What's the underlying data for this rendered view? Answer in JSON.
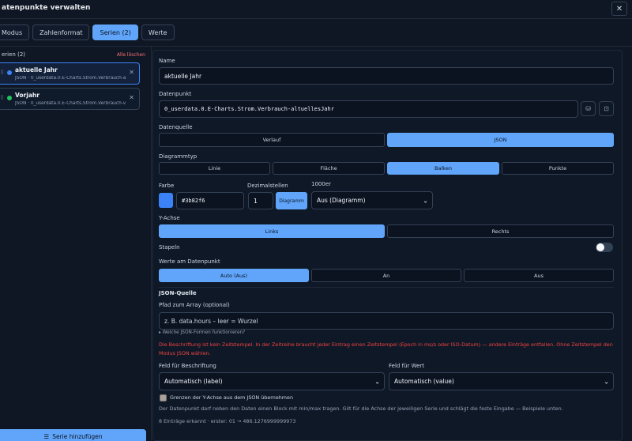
{
  "window": {
    "title": "atenpunkte verwalten",
    "close_glyph": "✕"
  },
  "tabs": [
    {
      "label": "Modus"
    },
    {
      "label": "Zahlenformat"
    },
    {
      "label": "Serien (2)"
    },
    {
      "label": "Werte"
    }
  ],
  "sidebar": {
    "header": "erien (2)",
    "clear_all": "Alle löschen",
    "items": [
      {
        "name": "aktuelle Jahr",
        "sub": "JSON · 0_userdata.0.E-Charts.Strom.Verbrauch-a...",
        "dot_color": "#3b82f6"
      },
      {
        "name": "Vorjahr",
        "sub": "JSON · 0_userdata.0.E-Charts.Strom.Verbrauch-v...",
        "dot_color": "#22c55e"
      }
    ],
    "add_button": "Serie hinzufügen"
  },
  "form": {
    "name_label": "Name",
    "name_value": "aktuelle Jahr",
    "datapoint_label": "Datenpunkt",
    "datapoint_value": "0_userdata.0.E-Charts.Strom.Verbrauch-altuellesJahr",
    "source_label": "Datenquelle",
    "source_options": [
      "Verlauf",
      "JSON"
    ],
    "chart_type_label": "Diagrammtyp",
    "chart_type_options": [
      "Linie",
      "Fläche",
      "Balken",
      "Punkte"
    ],
    "color_label": "Farbe",
    "color_value": "#3b82f6",
    "decimals_label": "Dezimalstellen",
    "decimals_value": "1",
    "decimals_button": "Diagramm",
    "thousands_label": "1000er",
    "thousands_value": "Aus (Diagramm)",
    "yaxis_label": "Y-Achse",
    "yaxis_options": [
      "Links",
      "Rechts"
    ],
    "stack_label": "Stapeln",
    "values_label": "Werte am Datenpunkt",
    "values_options": [
      "Auto (Aus)",
      "An",
      "Aus"
    ],
    "json_section": "JSON-Quelle",
    "array_path_label": "Pfad zum Array (optional)",
    "array_path_placeholder": "z. B. data.hours – leer = Wurzel",
    "json_forms_hint": "▸ Welche JSON-Formen funktionieren?",
    "error_text": "Die Beschriftung ist kein Zeitstempel. In der Zeitreihe braucht jeder Eintrag einen Zeitstempel (Epoch in ms/s oder ISO-Datum) — andere Einträge entfallen. Ohne Zeitstempel den Modus JSON wählen.",
    "label_field_label": "Feld für Beschriftung",
    "label_field_value": "Automatisch (label)",
    "value_field_label": "Feld für Wert",
    "value_field_value": "Automatisch (value)",
    "yaxis_limits_label": "Grenzen der Y-Achse aus dem JSON übernehmen",
    "yaxis_limits_desc": "Der Datenpunkt darf neben den Daten einen Block mit min/max tragen. Gilt für die Achse der jeweiligen Serie und schlägt die feste Eingabe — Beispiele unten.",
    "entries_info": "8 Einträge erkannt · erster: 01 → 486.1276999999973"
  }
}
